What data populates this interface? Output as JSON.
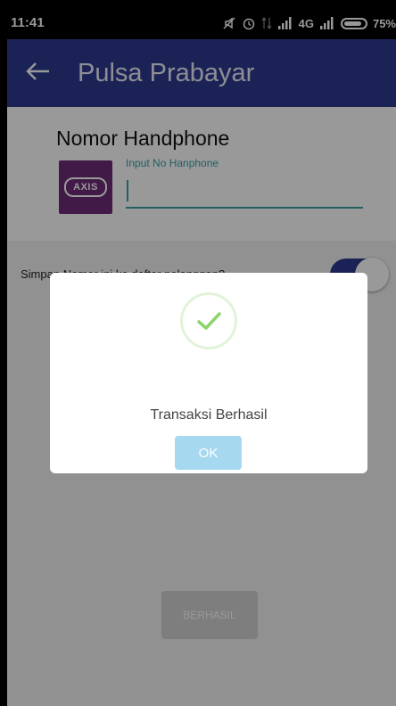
{
  "status_bar": {
    "time": "11:41",
    "network": "4G",
    "battery": "75%"
  },
  "app_bar": {
    "title": "Pulsa Prabayar"
  },
  "phone_section": {
    "title": "Nomor Handphone",
    "operator": "AXIS",
    "input_label": "Input No Hanphone",
    "input_value": ""
  },
  "save_option": {
    "label": "Simpan Nomor ini ke daftar pelanggan?",
    "toggle_on": true
  },
  "bottom_button": {
    "label": "BERHASIL"
  },
  "dialog": {
    "message": "Transaksi Berhasil",
    "ok_label": "OK"
  },
  "colors": {
    "primary": "#2e3b8f",
    "accent_teal": "#3aa0a2",
    "success_green": "#8cd46a",
    "ok_button": "#a6d8f0",
    "operator_purple": "#6d2c78"
  },
  "icons": {
    "back": "arrow-left",
    "status": [
      "mute-icon",
      "alarm-icon",
      "data-icon",
      "signal-icon",
      "signal-icon",
      "battery-icon"
    ],
    "dialog": "checkmark"
  }
}
